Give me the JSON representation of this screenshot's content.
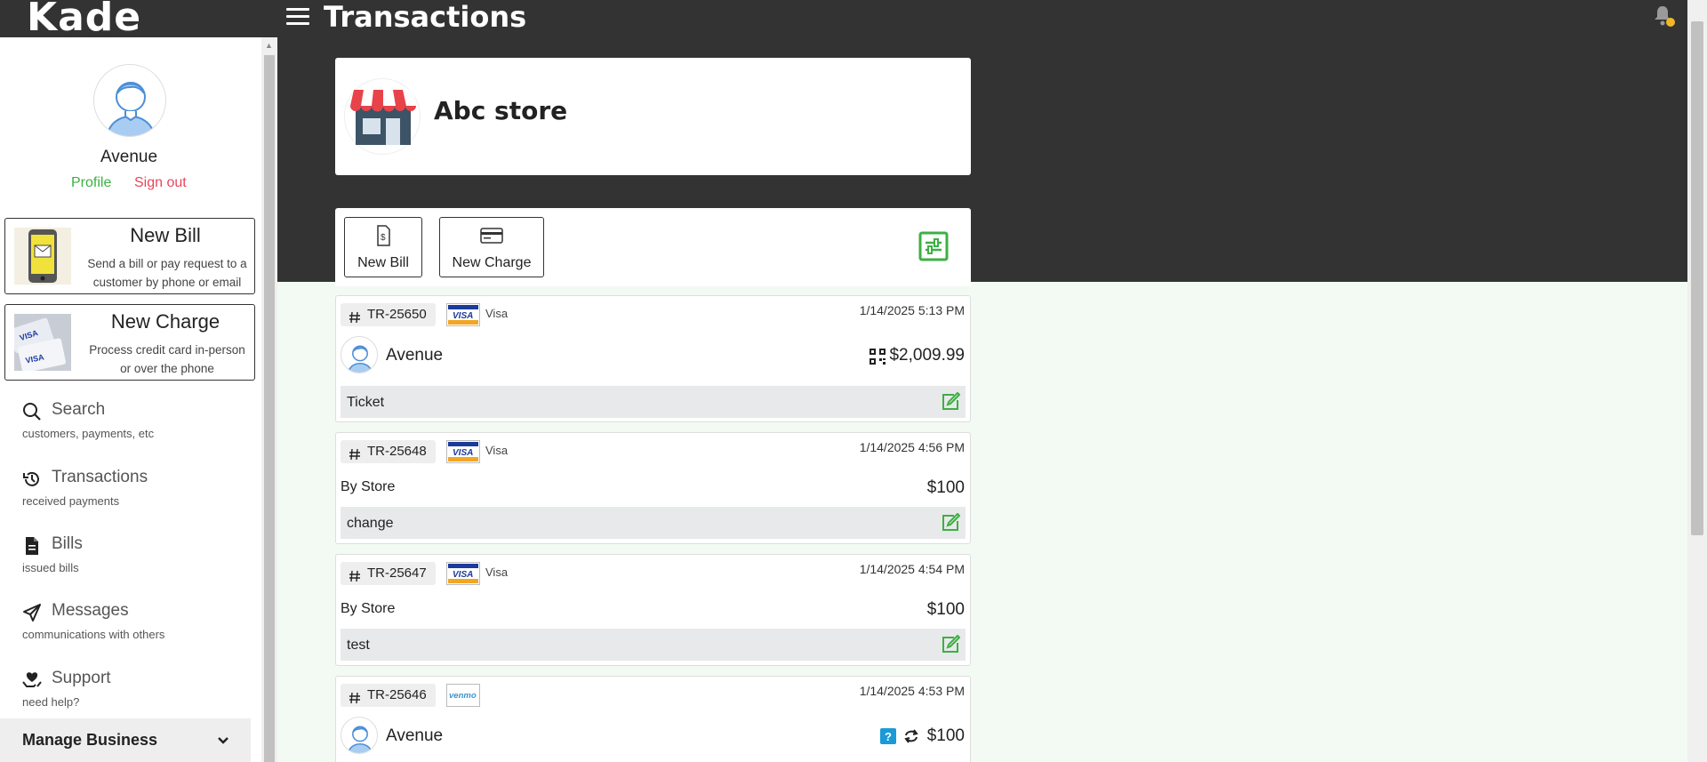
{
  "header": {
    "logo": "Kade",
    "title": "Transactions"
  },
  "user": {
    "name": "Avenue",
    "profile_label": "Profile",
    "signout_label": "Sign out"
  },
  "actions": [
    {
      "title": "New Bill",
      "desc": "Send a bill or pay request to a customer by phone or email"
    },
    {
      "title": "New Charge",
      "desc": "Process credit card in-person or over the phone"
    }
  ],
  "nav": [
    {
      "label": "Search",
      "sub": "customers, payments, etc"
    },
    {
      "label": "Transactions",
      "sub": "received payments"
    },
    {
      "label": "Bills",
      "sub": "issued bills"
    },
    {
      "label": "Messages",
      "sub": "communications with others"
    },
    {
      "label": "Support",
      "sub": "need help?"
    }
  ],
  "manage_business": "Manage Business",
  "store": {
    "name": "Abc store"
  },
  "toolbar": {
    "new_bill": "New Bill",
    "new_charge": "New Charge"
  },
  "transactions": [
    {
      "id": "TR-25650",
      "brand": "Visa",
      "card": "VISA",
      "date": "1/14/2025 5:13 PM",
      "party": "Avenue",
      "amount": "$2,009.99",
      "note": "Ticket"
    },
    {
      "id": "TR-25648",
      "brand": "Visa",
      "card": "VISA",
      "date": "1/14/2025 4:56 PM",
      "party": "By Store",
      "amount": "$100",
      "note": "change"
    },
    {
      "id": "TR-25647",
      "brand": "Visa",
      "card": "VISA",
      "date": "1/14/2025 4:54 PM",
      "party": "By Store",
      "amount": "$100",
      "note": "test"
    },
    {
      "id": "TR-25646",
      "brand": "",
      "card": "venmo",
      "date": "1/14/2025 4:53 PM",
      "party": "Avenue",
      "amount": "$100",
      "note": ""
    }
  ],
  "colors": {
    "header_bg": "#333333",
    "page_bg": "#f3faf3",
    "green": "#3cb043",
    "red": "#e8465a"
  }
}
